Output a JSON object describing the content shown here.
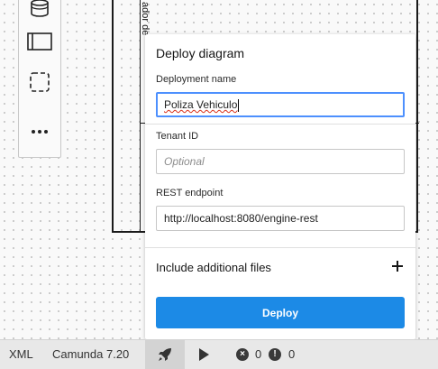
{
  "palette": {
    "items": [
      "database-icon",
      "pool-icon",
      "group-icon",
      "more-icon"
    ]
  },
  "diagram": {
    "pool_label": "ador de"
  },
  "deploy": {
    "title": "Deploy diagram",
    "deployment_name_label": "Deployment name",
    "deployment_name_value": "Poliza Vehiculo",
    "tenant_label": "Tenant ID",
    "tenant_placeholder": "Optional",
    "endpoint_label": "REST endpoint",
    "endpoint_value": "http://localhost:8080/engine-rest",
    "include_label": "Include additional files",
    "deploy_button": "Deploy",
    "accent": "#1c8ae6"
  },
  "statusbar": {
    "xml": "XML",
    "engine": "Camunda 7.20",
    "errors": "0",
    "warnings": "0"
  }
}
